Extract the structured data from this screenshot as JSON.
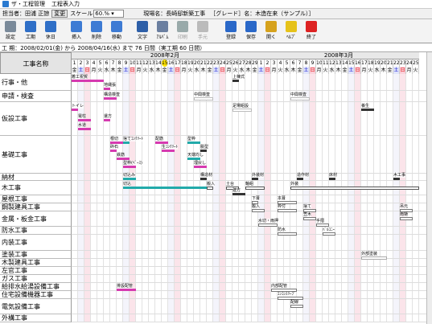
{
  "titlebar": {
    "app": "ザ・工程管理",
    "menu": "工程表入力"
  },
  "info": {
    "person_label": "担当者：",
    "person": "田浦 正諒",
    "change_button": "変更",
    "scale_label": "スケール",
    "scale_value": "60.% ▾",
    "site_label": "現場名：",
    "site": "長崎邸新築工事",
    "grade_label": "［グレード］名：",
    "grade": "木造在来（サンプル）］"
  },
  "toolbar": [
    {
      "label": "設定",
      "color": "#7a8a9a",
      "icon": "settings-icon",
      "enabled": true
    },
    {
      "label": "工期",
      "color": "#2f6fc7",
      "icon": "calendar-icon",
      "enabled": true
    },
    {
      "label": "休日",
      "color": "#2f6fc7",
      "icon": "holiday-icon",
      "enabled": true
    },
    {
      "label": "挿入",
      "color": "#3d7bd4",
      "icon": "insert-icon",
      "enabled": true
    },
    {
      "label": "削除",
      "color": "#3d7bd4",
      "icon": "delete-icon",
      "enabled": true
    },
    {
      "label": "移動",
      "color": "#3d7bd4",
      "icon": "move-icon",
      "enabled": true
    },
    {
      "label": "文字",
      "color": "#2d5fa8",
      "icon": "text-icon",
      "enabled": true
    },
    {
      "label": "ｱﾙﾊﾞﾑ",
      "color": "#6b7fa0",
      "icon": "album-icon",
      "enabled": true
    },
    {
      "label": "印刷",
      "color": "#9aa",
      "icon": "print-icon",
      "enabled": false
    },
    {
      "label": "手元",
      "color": "#bbb",
      "icon": "hand-icon",
      "enabled": false
    },
    {
      "label": "登録",
      "color": "#2a68c8",
      "icon": "register-icon",
      "enabled": true
    },
    {
      "label": "保存",
      "color": "#2a68c8",
      "icon": "save-icon",
      "enabled": true
    },
    {
      "label": "開く",
      "color": "#d6a21c",
      "icon": "open-icon",
      "enabled": true
    },
    {
      "label": "ﾍﾙﾌﾟ",
      "color": "#e6c219",
      "icon": "help-icon",
      "enabled": true
    },
    {
      "label": "終了",
      "color": "#d22",
      "icon": "exit-icon",
      "enabled": true
    }
  ],
  "period": "工 期：2008/02/01(金) から 2008/04/16(水) まで 76 日間（実工期 60 日間）",
  "corner_label": "工事名称",
  "months": [
    {
      "label": "2008年2月",
      "first": 1,
      "span": 29
    },
    {
      "label": "2008年3月",
      "first": 30,
      "span": 25
    }
  ],
  "today_marker": "15",
  "day_numbers": [
    "1",
    "2",
    "3",
    "4",
    "5",
    "6",
    "7",
    "8",
    "9",
    "10",
    "11",
    "12",
    "13",
    "14",
    "15",
    "16",
    "17",
    "18",
    "19",
    "20",
    "21",
    "22",
    "23",
    "24",
    "25",
    "26",
    "27",
    "28",
    "29",
    "1",
    "2",
    "3",
    "4",
    "5",
    "6",
    "7",
    "8",
    "9",
    "10",
    "11",
    "12",
    "13",
    "14",
    "15",
    "16",
    "17",
    "18",
    "19",
    "20",
    "21",
    "22",
    "23",
    "24",
    "25"
  ],
  "dow": [
    "金",
    "土",
    "日",
    "月",
    "火",
    "水",
    "木",
    "金",
    "土",
    "日",
    "月",
    "火",
    "水",
    "木",
    "金",
    "土",
    "日",
    "月",
    "火",
    "水",
    "木",
    "金",
    "土",
    "日",
    "月",
    "火",
    "水",
    "木",
    "金",
    "土",
    "日",
    "月",
    "火",
    "水",
    "木",
    "金",
    "土",
    "日",
    "月",
    "火",
    "水",
    "木",
    "金",
    "土",
    "日",
    "月",
    "火",
    "水",
    "木",
    "金",
    "土",
    "日",
    "月",
    "火"
  ],
  "rows": [
    {
      "label": "行事・他",
      "h": 21
    },
    {
      "label": "申請・検査",
      "h": 14
    },
    {
      "label": "仮設工事",
      "h": 42
    },
    {
      "label": "基礎工事",
      "h": 47
    },
    {
      "label": "納材",
      "h": 9
    },
    {
      "label": "木工事",
      "h": 18
    },
    {
      "label": "屋根工事",
      "h": 10
    },
    {
      "label": "鋼製建具工事",
      "h": 10
    },
    {
      "label": "金属・板金工事",
      "h": 19
    },
    {
      "label": "防水工事",
      "h": 10
    },
    {
      "label": "内装工事",
      "h": 20
    },
    {
      "label": "塗装工事",
      "h": 10
    },
    {
      "label": "木製建具工事",
      "h": 10
    },
    {
      "label": "左官工事",
      "h": 10
    },
    {
      "label": "ガス工事",
      "h": 10
    },
    {
      "label": "給排水給湯設備工事",
      "h": 10
    },
    {
      "label": "住宅設備機器工事",
      "h": 10
    },
    {
      "label": "電気設備工事",
      "h": 19
    },
    {
      "label": "外構工事",
      "h": 10
    }
  ],
  "tasks": [
    {
      "name": "着工祝賀",
      "row": 0,
      "off": 2,
      "d0": 0,
      "len": 5,
      "color": "#d63ab0"
    },
    {
      "name": "上棟式",
      "row": 0,
      "off": 2,
      "d0": 25,
      "len": 1,
      "color": "#333"
    },
    {
      "name": "地縄張",
      "row": 0,
      "off": 12,
      "d0": 5,
      "len": 1,
      "color": "#d63ab0"
    },
    {
      "name": "構造検査",
      "row": 1,
      "off": 3,
      "d0": 5,
      "len": 2,
      "color": "#d63ab0"
    },
    {
      "name": "中間検査",
      "row": 1,
      "off": 3,
      "d0": 19,
      "len": 3,
      "color": "#bbb"
    },
    {
      "name": "中間検査",
      "row": 1,
      "off": 3,
      "d0": 34,
      "len": 3,
      "color": "#bbb"
    },
    {
      "name": "トイレ",
      "row": 2,
      "off": 3,
      "d0": 0,
      "len": 1,
      "color": "#d63ab0"
    },
    {
      "name": "足場組設",
      "row": 2,
      "off": 3,
      "d0": 25,
      "len": 3,
      "color": "#bbb"
    },
    {
      "name": "養生",
      "row": 2,
      "off": 3,
      "d0": 45,
      "len": 2,
      "color": "#333"
    },
    {
      "name": "電柱",
      "row": 2,
      "off": 16,
      "d0": 1,
      "len": 2,
      "color": "#d63ab0"
    },
    {
      "name": "遣方",
      "row": 2,
      "off": 16,
      "d0": 5,
      "len": 1,
      "color": "#d63ab0"
    },
    {
      "name": "水道",
      "row": 2,
      "off": 27,
      "d0": 1,
      "len": 2,
      "color": "#d63ab0"
    },
    {
      "name": "根切",
      "row": 3,
      "off": 2,
      "d0": 6,
      "len": 2,
      "color": "#d63ab0"
    },
    {
      "name": "捨てｺﾝｸﾘｰﾄ",
      "row": 3,
      "off": 2,
      "d0": 8,
      "len": 1,
      "color": "#2aa"
    },
    {
      "name": "配筋",
      "row": 3,
      "off": 2,
      "d0": 13,
      "len": 2,
      "color": "#d63ab0"
    },
    {
      "name": "型枠",
      "row": 3,
      "off": 2,
      "d0": 18,
      "len": 2,
      "color": "#2aa"
    },
    {
      "name": "砕石",
      "row": 3,
      "off": 12,
      "d0": 6,
      "len": 1,
      "color": "#d63ab0"
    },
    {
      "name": "生ｺﾝｸﾘｰﾄ",
      "row": 3,
      "off": 12,
      "d0": 14,
      "len": 2,
      "color": "#d63ab0"
    },
    {
      "name": "脱型",
      "row": 3,
      "off": 12,
      "d0": 20,
      "len": 1,
      "color": "#333"
    },
    {
      "name": "鉄筋",
      "row": 3,
      "off": 22,
      "d0": 7,
      "len": 2,
      "color": "#d63ab0"
    },
    {
      "name": "天端均し",
      "row": 3,
      "off": 22,
      "d0": 18,
      "len": 2,
      "color": "#2aa"
    },
    {
      "name": "型枠(ﾍﾞｰｽ)",
      "row": 3,
      "off": 32,
      "d0": 8,
      "len": 2,
      "color": "#d63ab0"
    },
    {
      "name": "埋戻し",
      "row": 3,
      "off": 32,
      "d0": 19,
      "len": 2,
      "color": "#d63ab0"
    },
    {
      "name": "切込み",
      "row": 4,
      "off": 0,
      "d0": 8,
      "len": 2,
      "color": "#2aa"
    },
    {
      "name": "構造材",
      "row": 4,
      "off": 0,
      "d0": 20,
      "len": 1,
      "color": "#333"
    },
    {
      "name": "外装材",
      "row": 4,
      "off": 0,
      "d0": 28,
      "len": 1,
      "color": "#333"
    },
    {
      "name": "造作材",
      "row": 4,
      "off": 0,
      "d0": 35,
      "len": 1,
      "color": "#333"
    },
    {
      "name": "床材",
      "row": 4,
      "off": 0,
      "d0": 40,
      "len": 1,
      "color": "#333"
    },
    {
      "name": "木工事",
      "row": 4,
      "off": 0,
      "d0": 50,
      "len": 1,
      "color": "#333"
    },
    {
      "name": "切込",
      "row": 5,
      "off": 2,
      "d0": 8,
      "len": 13,
      "color": "#2aa"
    },
    {
      "name": "搬入",
      "row": 5,
      "off": 2,
      "d0": 21,
      "len": 1,
      "color": "#555"
    },
    {
      "name": "土台",
      "row": 5,
      "off": 2,
      "d0": 24,
      "len": 2,
      "color": "#555"
    },
    {
      "name": "軸組",
      "row": 5,
      "off": 2,
      "d0": 27,
      "len": 3,
      "color": "#555"
    },
    {
      "name": "外装",
      "row": 5,
      "off": 2,
      "d0": 34,
      "len": 20,
      "color": "#555"
    },
    {
      "name": "建方",
      "row": 5,
      "off": 10,
      "d0": 25,
      "len": 2,
      "color": "#333"
    },
    {
      "name": "下葺",
      "row": 6,
      "off": 2,
      "d0": 28,
      "len": 1,
      "color": "#777"
    },
    {
      "name": "本葺",
      "row": 6,
      "off": 2,
      "d0": 32,
      "len": 3,
      "color": "#777"
    },
    {
      "name": "搬入",
      "row": 7,
      "off": 2,
      "d0": 28,
      "len": 2,
      "color": "#777"
    },
    {
      "name": "枠付",
      "row": 7,
      "off": 2,
      "d0": 32,
      "len": 3,
      "color": "#777"
    },
    {
      "name": "捨て",
      "row": 7,
      "off": 2,
      "d0": 36,
      "len": 2,
      "color": "#777"
    },
    {
      "name": "吊元",
      "row": 7,
      "off": 2,
      "d0": 51,
      "len": 2,
      "color": "#777"
    },
    {
      "name": "笠木",
      "row": 8,
      "off": 2,
      "d0": 36,
      "len": 2,
      "color": "#777"
    },
    {
      "name": "雨樋",
      "row": 8,
      "off": 2,
      "d0": 51,
      "len": 2,
      "color": "#777"
    },
    {
      "name": "水切・雨押",
      "row": 8,
      "off": 10,
      "d0": 29,
      "len": 3,
      "color": "#777"
    },
    {
      "name": "手摺",
      "row": 8,
      "off": 10,
      "d0": 38,
      "len": 2,
      "color": "#777"
    },
    {
      "name": "防水",
      "row": 9,
      "off": 2,
      "d0": 32,
      "len": 3,
      "color": "#777"
    },
    {
      "name": "ﾊﾞﾙｺﾆｰ",
      "row": 9,
      "off": 2,
      "d0": 39,
      "len": 2,
      "color": "#777"
    },
    {
      "name": "外部塗装",
      "row": 11,
      "off": 2,
      "d0": 45,
      "len": 4,
      "color": "#aaa"
    },
    {
      "name": "排設配管",
      "row": 15,
      "off": 2,
      "d0": 7,
      "len": 3,
      "color": "#d63ab0"
    },
    {
      "name": "内部配管",
      "row": 15,
      "off": 2,
      "d0": 31,
      "len": 4,
      "color": "#777"
    },
    {
      "name": "ｴﾝｺﾝｽﾘｰﾌﾞ",
      "row": 16,
      "off": 2,
      "d0": 32,
      "len": 4,
      "color": "#777"
    },
    {
      "name": "配線",
      "row": 17,
      "off": 2,
      "d0": 34,
      "len": 2,
      "color": "#777"
    }
  ]
}
